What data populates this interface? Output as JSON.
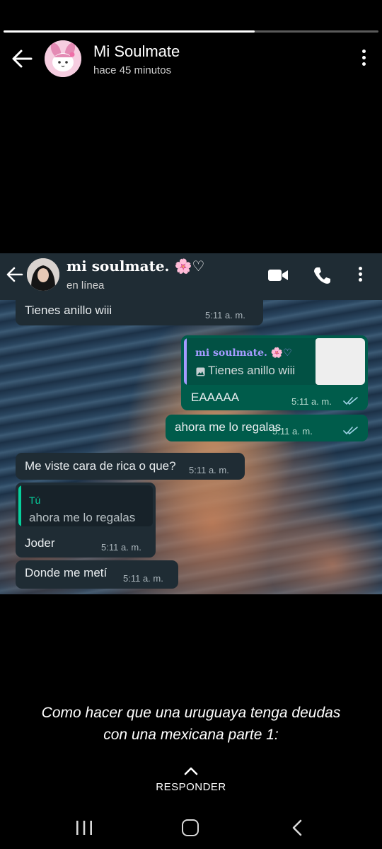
{
  "story": {
    "progress_fraction": 0.67,
    "contact_name": "Mi Soulmate",
    "time_ago": "hace 45 minutos",
    "caption_line1": "Como hacer que una uruguaya tenga deudas",
    "caption_line2": "con una mexicana parte 1:",
    "reply_label": "RESPONDER"
  },
  "chat": {
    "name": "mi soulmate. 🌸♡",
    "status": "en línea",
    "messages": [
      {
        "direction": "in",
        "text": "Tienes anillo wiii",
        "time": "5:11 a. m."
      },
      {
        "direction": "out",
        "quote_author": "mi soulmate. 🌸♡",
        "quote_text": "Tienes anillo wiii",
        "text": "EAAAAA",
        "time": "5:11 a. m."
      },
      {
        "direction": "out",
        "text": "ahora me lo regalas",
        "time": "5:11 a. m."
      },
      {
        "direction": "in",
        "text": "Me viste cara de rica o que?",
        "time": "5:11 a. m."
      },
      {
        "direction": "in",
        "quote_author": "Tú",
        "quote_text": "ahora me lo regalas",
        "text": "Joder",
        "time": "5:11 a. m."
      },
      {
        "direction": "in",
        "text": "Donde me metí",
        "time": "5:11 a. m."
      }
    ]
  },
  "icons": {
    "story_back": "arrow-left-icon",
    "story_menu": "more-vertical-icon",
    "chat_back": "arrow-left-icon",
    "video_call": "video-camera-icon",
    "voice_call": "phone-icon",
    "chat_menu": "more-vertical-icon",
    "quote_photo": "image-icon",
    "read_ticks": "double-check-icon",
    "reply": "chevron-up-icon",
    "nav_recent": "recent-apps-icon",
    "nav_home": "home-icon",
    "nav_back": "nav-back-icon"
  },
  "colors": {
    "background": "#000000",
    "incoming_bubble": "#1f2c34",
    "outgoing_bubble": "#005c4b",
    "quote_purple": "#a59bff",
    "quote_green": "#06cf9c",
    "read_ticks": "#9fd3e6"
  }
}
